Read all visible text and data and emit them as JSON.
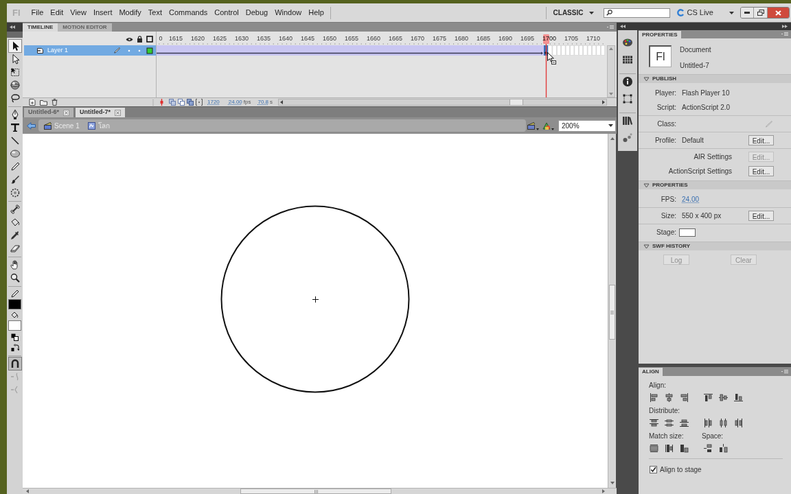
{
  "menu_bar": {
    "logo": "Fl",
    "items": [
      "File",
      "Edit",
      "View",
      "Insert",
      "Modify",
      "Text",
      "Commands",
      "Control",
      "Debug",
      "Window",
      "Help"
    ],
    "workspace": "CLASSIC",
    "cs_live": "CS Live"
  },
  "toolbar": {
    "tool_groups": [
      {
        "tools": [
          {
            "kind": "selection",
            "selected": true
          },
          {
            "kind": "subselection",
            "selected": false
          },
          {
            "kind": "transform",
            "selected": false
          },
          {
            "kind": "rotation",
            "selected": false
          },
          {
            "kind": "lasso",
            "selected": false
          }
        ]
      },
      {
        "tools": [
          {
            "kind": "pen",
            "selected": false
          },
          {
            "kind": "text",
            "selected": false
          },
          {
            "kind": "line",
            "selected": false
          },
          {
            "kind": "oval",
            "selected": false
          },
          {
            "kind": "pencil",
            "selected": false
          },
          {
            "kind": "brush",
            "selected": false
          },
          {
            "kind": "deco",
            "selected": false
          }
        ]
      },
      {
        "tools": [
          {
            "kind": "bone",
            "selected": false
          },
          {
            "kind": "bucket",
            "selected": false
          },
          {
            "kind": "eyedropper",
            "selected": false
          },
          {
            "kind": "eraser",
            "selected": false
          }
        ]
      },
      {
        "tools": [
          {
            "kind": "hand",
            "selected": false
          },
          {
            "kind": "zoom",
            "selected": false
          }
        ]
      }
    ],
    "swatches": [
      {
        "kind": "stroke",
        "color": "#000000"
      },
      {
        "kind": "fill",
        "color": "#ffffff"
      }
    ],
    "options": [
      {
        "kind": "snap",
        "on": true,
        "disabled": false
      },
      {
        "kind": "smooth",
        "on": false,
        "disabled": true
      },
      {
        "kind": "straighten",
        "on": false,
        "disabled": true
      }
    ]
  },
  "timeline": {
    "tabs": [
      {
        "label": "TIMELINE",
        "selected": true
      },
      {
        "label": "MOTION EDITOR",
        "selected": false
      }
    ],
    "ruler": [
      {
        "label": "0",
        "selected": false
      },
      {
        "label": "1615",
        "selected": false
      },
      {
        "label": "1620",
        "selected": false
      },
      {
        "label": "1625",
        "selected": false
      },
      {
        "label": "1630",
        "selected": false
      },
      {
        "label": "1635",
        "selected": false
      },
      {
        "label": "1640",
        "selected": false
      },
      {
        "label": "1645",
        "selected": false
      },
      {
        "label": "1650",
        "selected": false
      },
      {
        "label": "1655",
        "selected": false
      },
      {
        "label": "1660",
        "selected": false
      },
      {
        "label": "1665",
        "selected": false
      },
      {
        "label": "1670",
        "selected": false
      },
      {
        "label": "1675",
        "selected": false
      },
      {
        "label": "1680",
        "selected": false
      },
      {
        "label": "1685",
        "selected": false
      },
      {
        "label": "1690",
        "selected": false
      },
      {
        "label": "1695",
        "selected": false
      },
      {
        "label": "1700",
        "selected": true
      },
      {
        "label": "1705",
        "selected": false
      },
      {
        "label": "1710",
        "selected": false
      }
    ],
    "layers": [
      {
        "name": "Layer 1",
        "selected": true,
        "visible": true,
        "locked": false,
        "color": "#33cc33"
      }
    ],
    "footer": {
      "current_frame": "1720",
      "frame_rate": "24.00",
      "frame_rate_unit": "fps",
      "elapsed": "70.8",
      "elapsed_unit": "s"
    }
  },
  "document_tabs": [
    {
      "label": "Untitled-6*",
      "selected": false
    },
    {
      "label": "Untitled-7*",
      "selected": true
    }
  ],
  "breadcrumb": [
    {
      "kind": "scene",
      "label": "Scene 1"
    },
    {
      "kind": "symbol",
      "label": "โลก"
    }
  ],
  "zoom": "200%",
  "properties_panel": {
    "tab": "PROPERTIES",
    "document_icon": "Fl",
    "document_type": "Document",
    "document_name": "Untitled-7",
    "sections": [
      {
        "title": "PUBLISH",
        "expanded": true,
        "groups": [
          {
            "rows": [
              {
                "kind": "text",
                "label": "Player:",
                "value": "Flash Player 10"
              },
              {
                "kind": "text",
                "label": "Script:",
                "value": "ActionScript 2.0"
              }
            ]
          },
          {
            "rows": [
              {
                "kind": "pencil",
                "label": "Class:"
              }
            ]
          },
          {
            "rows": [
              {
                "kind": "valuebutton",
                "label": "Profile:",
                "value": "Default",
                "button": {
                  "label": "Edit...",
                  "disabled": false
                }
              }
            ]
          },
          {
            "rows": [
              {
                "kind": "button",
                "label": "AIR Settings",
                "button": {
                  "label": "Edit...",
                  "disabled": true
                }
              },
              {
                "kind": "button",
                "label": "ActionScript Settings",
                "button": {
                  "label": "Edit...",
                  "disabled": false
                }
              }
            ]
          }
        ]
      },
      {
        "title": "PROPERTIES",
        "expanded": true,
        "groups": [
          {
            "rows": [
              {
                "kind": "link",
                "label": "FPS:",
                "value": "24.00"
              }
            ]
          },
          {
            "rows": [
              {
                "kind": "valuebutton",
                "label": "Size:",
                "value": "550 x 400 px",
                "button": {
                  "label": "Edit...",
                  "disabled": false
                }
              }
            ]
          },
          {
            "rows": [
              {
                "kind": "swatch",
                "label": "Stage:",
                "color": "#ffffff"
              }
            ]
          }
        ]
      },
      {
        "title": "SWF HISTORY",
        "expanded": true,
        "buttons": [
          {
            "label": "Log",
            "disabled": true
          },
          {
            "label": "Clear",
            "disabled": true
          }
        ]
      }
    ]
  },
  "align_panel": {
    "tab": "ALIGN",
    "align_label": "Align:",
    "distribute_label": "Distribute:",
    "match_size_label": "Match size:",
    "space_label": "Space:",
    "align_to_stage": {
      "label": "Align to stage",
      "checked": true
    }
  }
}
